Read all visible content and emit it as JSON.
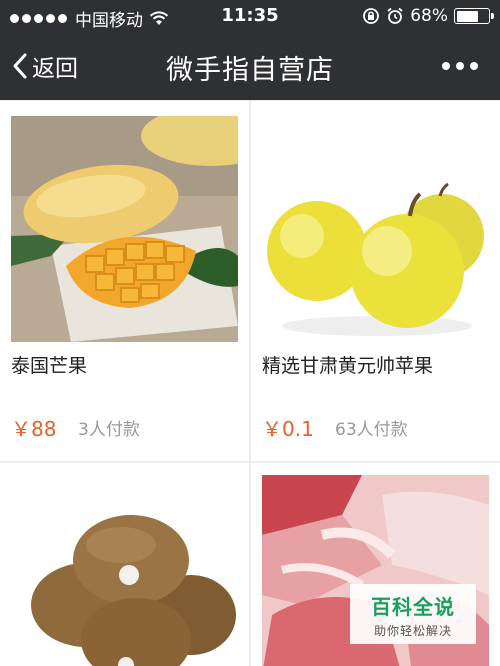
{
  "status_bar": {
    "carrier": "中国移动",
    "time": "11:35",
    "battery": "68%",
    "battery_level": 0.68
  },
  "nav": {
    "back_label": "返回",
    "title": "微手指自营店"
  },
  "products": [
    {
      "name": "泰国芒果",
      "price": "￥88",
      "sold": "3人付款"
    },
    {
      "name": "精选甘肃黄元帅苹果",
      "price": "￥0.1",
      "sold": "63人付款"
    },
    {
      "name": "",
      "price": "",
      "sold": ""
    },
    {
      "name": "",
      "price": "",
      "sold": ""
    }
  ],
  "watermark": {
    "main": "百科全说",
    "sub": "助你轻松解决"
  }
}
